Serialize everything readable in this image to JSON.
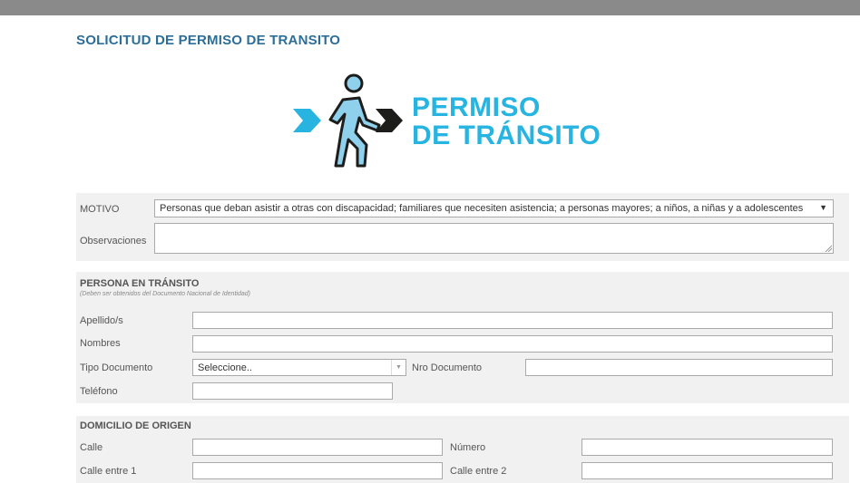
{
  "page": {
    "title": "SOLICITUD DE PERMISO DE TRANSITO"
  },
  "logo": {
    "line1": "PERMISO",
    "line2": "DE TRÁNSITO"
  },
  "motivo": {
    "label": "MOTIVO",
    "selected": "Personas que deban asistir a otras con discapacidad; familiares que necesiten asistencia; a personas mayores; a niños, a niñas y a adolescentes",
    "observaciones_label": "Observaciones",
    "observaciones_value": ""
  },
  "persona": {
    "title": "PERSONA EN TRÁNSITO",
    "subtitle": "(Deben ser obtenidos del Documento Nacional de Identidad)",
    "apellidos_label": "Apellido/s",
    "nombres_label": "Nombres",
    "tipo_doc_label": "Tipo Documento",
    "tipo_doc_selected": "Seleccione..",
    "nro_doc_label": "Nro Documento",
    "telefono_label": "Teléfono"
  },
  "domicilio": {
    "title": "DOMICILIO DE ORIGEN",
    "calle_label": "Calle",
    "numero_label": "Número",
    "calle_entre1_label": "Calle entre 1",
    "calle_entre2_label": "Calle entre 2"
  },
  "colors": {
    "title_blue": "#2d6e99",
    "logo_blue": "#27b4e0",
    "logo_dark": "#1d1d1b",
    "figure_fill": "#8fd0ec",
    "panel_bg": "#f1f1f1"
  }
}
